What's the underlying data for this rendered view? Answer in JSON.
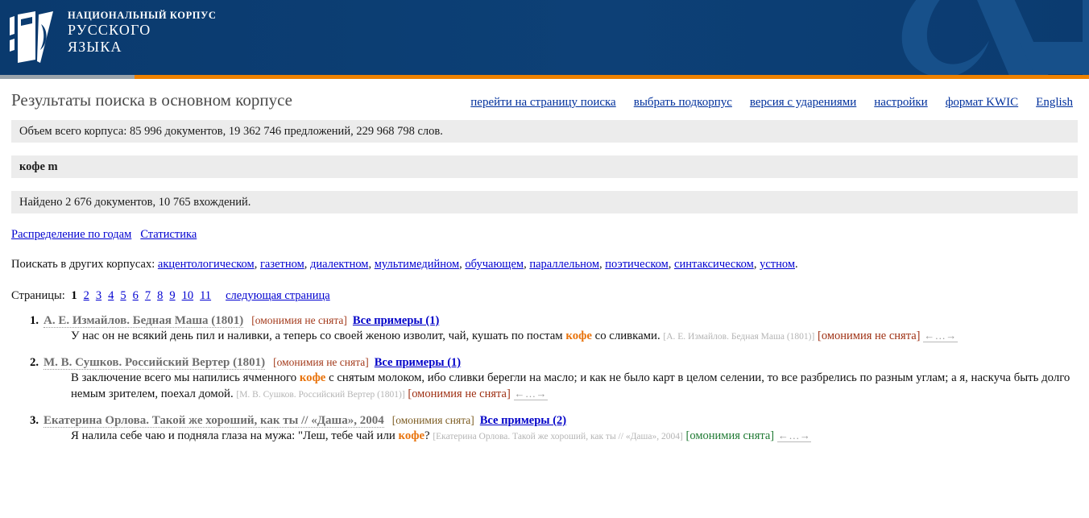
{
  "header": {
    "logo_line1": "НАЦИОНАЛЬНЫЙ КОРПУС",
    "logo_line2": "РУССКОГО",
    "logo_line3": "ЯЗЫКА",
    "logo_icon": "ruscorpora-book-logo",
    "watermark_icon": "lambda-watermark",
    "bar_color": "#ef8200",
    "bg_color": "#0b3c71"
  },
  "page": {
    "title": "Результаты поиска в основном корпусе",
    "nav": [
      {
        "label": "перейти на страницу поиска"
      },
      {
        "label": "выбрать подкорпус"
      },
      {
        "label": "версия с ударениями"
      },
      {
        "label": "настройки"
      },
      {
        "label": "формат KWIC"
      },
      {
        "label": "English"
      }
    ],
    "corpus_volume": "Объем всего корпуса: 85 996 документов, 19 362 746 предложений, 229 968 798 слов.",
    "query": "кофе  m",
    "found": "Найдено 2 676 документов, 10 765 вхождений.",
    "stat_links": [
      {
        "label": "Распределение по годам"
      },
      {
        "label": "Статистика"
      }
    ],
    "other_corpora_label": "Поискать в других корпусах:",
    "other_corpora": [
      "акцентологическом",
      "газетном",
      "диалектном",
      "мультимедийном",
      "обучающем",
      "параллельном",
      "поэтическом",
      "синтаксическом",
      "устном"
    ],
    "pages_label": "Страницы:",
    "pages_current": "1",
    "pages": [
      "2",
      "3",
      "4",
      "5",
      "6",
      "7",
      "8",
      "9",
      "10",
      "11"
    ],
    "next_page": "следующая страница"
  },
  "results": [
    {
      "num": "1.",
      "title": "А. Е. Измайлов. Бедная Маша (1801)",
      "homonymy_head": "[омонимия не снята]",
      "all_examples": "Все примеры (1)",
      "snippet_before": "У нас он не всякий день пил и наливки, а теперь со своей женою изволит, чай, кушать по постам ",
      "keyword": "кофе",
      "snippet_after": " со сливками.",
      "cite": "[А. Е. Измайлов. Бедная Маша (1801)]",
      "homonymy": "[омонимия не снята]",
      "homonymy_color": "red",
      "arrows": "←…→"
    },
    {
      "num": "2.",
      "title": "М. В. Сушков. Российский Вертер (1801)",
      "homonymy_head": "[омонимия не снята]",
      "all_examples": "Все примеры (1)",
      "snippet_before": "В заключение всего мы напились ячменного ",
      "keyword": "кофе",
      "snippet_after": " с снятым молоком, ибо сливки берегли на масло; и как не было карт в целом селении, то все разбрелись по разным углам; а я, наскуча быть долго немым зрителем, поехал домой.",
      "cite": "[М. В. Сушков. Российский Вертер (1801)]",
      "homonymy": "[омонимия не снята]",
      "homonymy_color": "red",
      "arrows": "←…→"
    },
    {
      "num": "3.",
      "title": "Екатерина Орлова. Такой же хороший, как ты // «Даша», 2004",
      "homonymy_head": "[омонимия снята]",
      "all_examples": "Все примеры (2)",
      "snippet_before": "Я налила себе чаю и подняла глаза на мужа: \"Леш, тебе чай или ",
      "keyword": "кофе",
      "snippet_after": "?",
      "cite": "[Екатерина Орлова. Такой же хороший, как ты // «Даша», 2004]",
      "homonymy": "[омонимия снята]",
      "homonymy_color": "green",
      "arrows": "←…→"
    }
  ]
}
